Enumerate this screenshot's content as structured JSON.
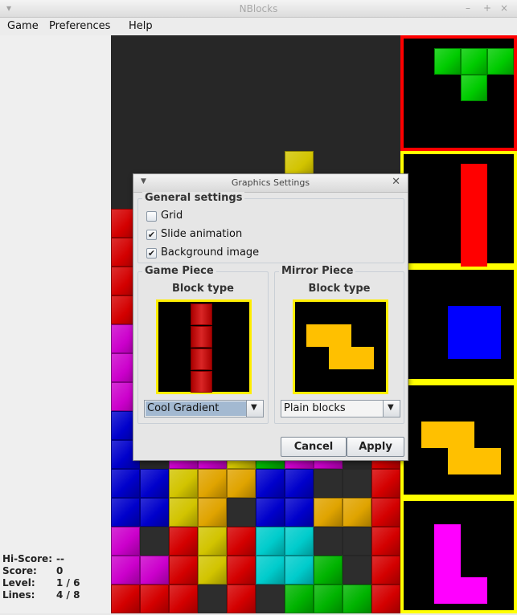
{
  "window": {
    "title": "NBlocks",
    "controls": [
      "–",
      "+",
      "×"
    ]
  },
  "menu": [
    "Game",
    "Preferences",
    "Help"
  ],
  "stats": [
    {
      "label": "Hi-Score:",
      "value": "--"
    },
    {
      "label": "Score:",
      "value": "0"
    },
    {
      "label": "Level:",
      "value": "1 / 6"
    },
    {
      "label": "Lines:",
      "value": "4 / 8"
    }
  ],
  "colors": {
    "red": "#d40000",
    "magenta": "#cc00cc",
    "blue": "#0000cc",
    "yellow": "#d2c400",
    "orange": "#e0a400",
    "green": "#00b400",
    "cyan": "#00cccc",
    "dark": "#2d2d2d",
    "active_border": "#ff0000",
    "preview_border": "#ffff00",
    "highlight": "#ffee00"
  },
  "board": {
    "columns": 10,
    "rows": 20,
    "falling_piece": [
      [
        6,
        4
      ]
    ],
    "stack": [
      "R.........",
      "R.........",
      "R.........",
      "R.........",
      "M.........",
      "M.........",
      "M.........",
      "B.........",
      "B.MMYGMM.R",
      "BBYOOBBDDR",
      "BBYODBBOOR",
      "MDRYRCCDDR",
      "MMRYRCCGDR",
      "RRRDRDGGGR"
    ]
  },
  "previews": [
    {
      "color": "#00cc00",
      "blocks": [
        [
          1,
          0
        ],
        [
          2,
          0
        ],
        [
          3,
          0
        ],
        [
          2,
          1
        ]
      ],
      "active": true
    },
    {
      "color": "#ff0000",
      "blocks": [
        [
          2,
          0
        ],
        [
          2,
          1
        ],
        [
          2,
          2
        ],
        [
          2,
          3
        ]
      ],
      "active": false
    },
    {
      "color": "#0000ff",
      "blocks": [
        [
          1.5,
          1
        ],
        [
          2.5,
          1
        ],
        [
          1.5,
          2
        ],
        [
          2.5,
          2
        ]
      ],
      "active": false
    },
    {
      "color": "#ffc000",
      "blocks": [
        [
          0.5,
          1
        ],
        [
          1.5,
          1
        ],
        [
          1.5,
          2
        ],
        [
          2.5,
          2
        ]
      ],
      "active": false
    },
    {
      "color": "#ff00ff",
      "blocks": [
        [
          1,
          0.5
        ],
        [
          1,
          1.5
        ],
        [
          1,
          2.5
        ],
        [
          2,
          2.5
        ]
      ],
      "active": false
    }
  ],
  "dialog": {
    "title": "Graphics Settings",
    "general": {
      "title": "General settings",
      "options": [
        {
          "label": "Grid",
          "checked": false
        },
        {
          "label": "Slide animation",
          "checked": true
        },
        {
          "label": "Background image",
          "checked": true
        }
      ]
    },
    "game_piece": {
      "title": "Game Piece",
      "block_type_label": "Block type",
      "selected": "Cool Gradient",
      "sample_color": "#d40000"
    },
    "mirror_piece": {
      "title": "Mirror Piece",
      "block_type_label": "Block type",
      "selected": "Plain blocks",
      "sample_color": "#ffc000"
    },
    "buttons": {
      "cancel": "Cancel",
      "apply": "Apply"
    },
    "check_mark": "✔",
    "arrow_down": "▼"
  }
}
